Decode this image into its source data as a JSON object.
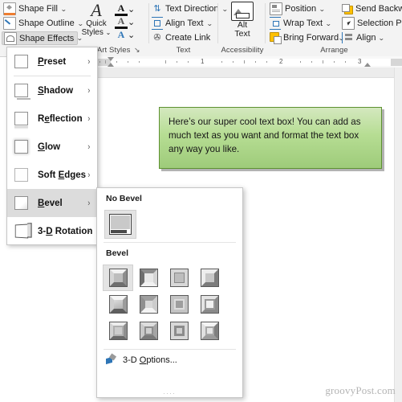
{
  "ribbon": {
    "groups": [
      {
        "name": "shape-styles",
        "label": "",
        "commands": [
          {
            "label": "Shape Fill",
            "icon": "shape-fill-icon",
            "chevron": "⌄",
            "active": false
          },
          {
            "label": "Shape Outline",
            "icon": "shape-outline-icon",
            "chevron": "⌄",
            "active": false
          },
          {
            "label": "Shape Effects",
            "icon": "shape-effects-icon",
            "chevron": "⌄",
            "active": true
          }
        ]
      },
      {
        "name": "wordart-styles",
        "label": "dArt Styles",
        "quick_styles_line1": "Quick",
        "quick_styles_line2": "Styles",
        "quick_styles_chevron": "⌄",
        "wordart_rows": [
          {
            "glyph": "A",
            "icon": "text-fill-icon",
            "chevron": "⌄"
          },
          {
            "glyph": "A",
            "icon": "text-outline-icon",
            "chevron": "⌄"
          },
          {
            "glyph": "A",
            "icon": "text-effects-icon",
            "chevron": "⌄"
          }
        ],
        "dialog_launcher": "↘"
      },
      {
        "name": "text",
        "label": "Text",
        "commands": [
          {
            "label": "Text Direction",
            "icon": "text-direction-icon",
            "chevron": "⌄"
          },
          {
            "label": "Align Text",
            "icon": "align-text-icon",
            "chevron": "⌄"
          },
          {
            "label": "Create Link",
            "icon": "create-link-icon",
            "chevron": ""
          }
        ]
      },
      {
        "name": "accessibility",
        "label": "Accessibility",
        "alt_text_line1": "Alt",
        "alt_text_line2": "Text",
        "alt_text_icon": "alt-text-icon"
      },
      {
        "name": "arrange",
        "label": "Arrange",
        "commands_col1": [
          {
            "label": "Position",
            "icon": "position-icon",
            "chevron": "⌄"
          },
          {
            "label": "Wrap Text",
            "icon": "wrap-text-icon",
            "chevron": "⌄"
          },
          {
            "label": "Bring Forward",
            "icon": "bring-forward-icon",
            "chevron": "⌄"
          }
        ],
        "commands_col2": [
          {
            "label": "Send Backward",
            "icon": "send-backward-icon",
            "chevron": "⌄"
          },
          {
            "label": "Selection Pane",
            "icon": "selection-pane-icon",
            "chevron": ""
          },
          {
            "label": "Align",
            "icon": "align-objects-icon",
            "chevron": "⌄"
          }
        ]
      }
    ]
  },
  "ruler": {
    "numbers": [
      "1",
      "2",
      "3"
    ]
  },
  "document": {
    "textbox": {
      "text": "Here’s our super cool text box! You can add as much text as you want and format the text box any way you like.",
      "fill_color": "#b6dd93",
      "border_color": "#5e9131"
    },
    "watermark": "groovyPost.com"
  },
  "shape_effects_menu": {
    "items": [
      {
        "label": "Preset",
        "mnemonic": "P",
        "icon": "preset-swatch-icon",
        "arrow": "›",
        "selected": false
      },
      {
        "label": "Shadow",
        "mnemonic": "S",
        "icon": "shadow-swatch-icon",
        "arrow": "›",
        "selected": false
      },
      {
        "label": "Reflection",
        "mnemonic": "e",
        "icon": "reflection-swatch-icon",
        "arrow": "›",
        "selected": false
      },
      {
        "label": "Glow",
        "mnemonic": "G",
        "icon": "glow-swatch-icon",
        "arrow": "›",
        "selected": false
      },
      {
        "label": "Soft Edges",
        "mnemonic": "E",
        "icon": "soft-edges-swatch-icon",
        "arrow": "›",
        "selected": false
      },
      {
        "label": "Bevel",
        "mnemonic": "B",
        "icon": "bevel-swatch-icon",
        "arrow": "›",
        "selected": true
      },
      {
        "label": "3-D Rotation",
        "mnemonic": "D",
        "icon": "rotation-3d-swatch-icon",
        "arrow": "›",
        "selected": false
      }
    ]
  },
  "bevel_submenu": {
    "no_bevel_heading": "No Bevel",
    "no_bevel_tile": "no-bevel-thumbnail",
    "bevel_heading": "Bevel",
    "tiles": [
      {
        "name": "bevel-circle",
        "selected": true
      },
      {
        "name": "bevel-soft-round",
        "selected": false
      },
      {
        "name": "bevel-cross",
        "selected": false
      },
      {
        "name": "bevel-cool-slant",
        "selected": false
      },
      {
        "name": "bevel-angle",
        "selected": false
      },
      {
        "name": "bevel-divot",
        "selected": false
      },
      {
        "name": "bevel-riblet",
        "selected": false
      },
      {
        "name": "bevel-hard-edge",
        "selected": false
      },
      {
        "name": "bevel-art-deco",
        "selected": false
      },
      {
        "name": "bevel-relaxed-inset",
        "selected": false
      },
      {
        "name": "bevel-convex",
        "selected": false
      },
      {
        "name": "bevel-slope",
        "selected": false
      }
    ],
    "options_label": "3-D Options...",
    "options_icon": "3d-options-icon",
    "overflow_dots": "...."
  }
}
